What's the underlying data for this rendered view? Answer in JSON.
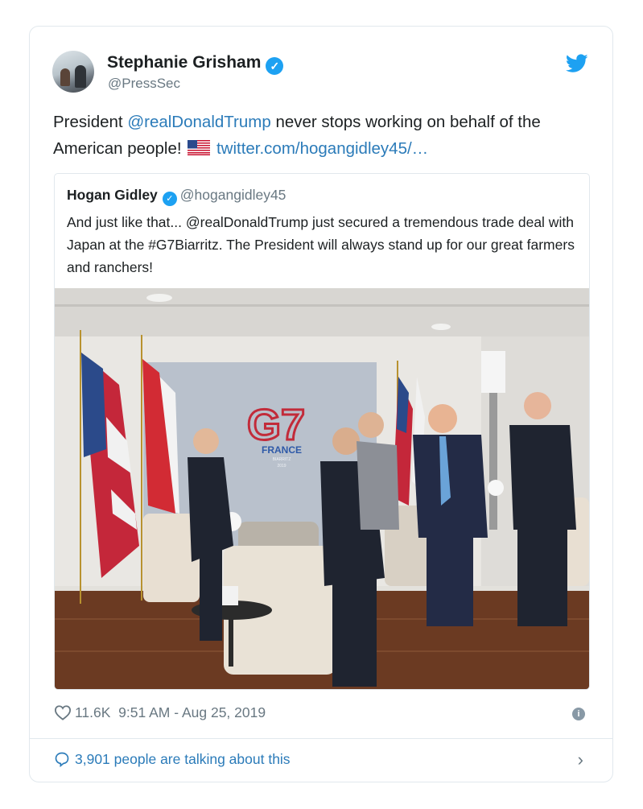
{
  "author": {
    "name": "Stephanie Grisham",
    "handle": "@PressSec",
    "verified_icon": "verified-check-icon"
  },
  "tweet": {
    "text_before_mention": "President ",
    "mention": "@realDonaldTrump",
    "text_after_mention": " never stops working on behalf of the American people! ",
    "flag_icon": "us-flag-emoji",
    "link": "twitter.com/hogangidley45/…"
  },
  "quote": {
    "name": "Hogan Gidley",
    "handle": "@hogangidley45",
    "text": "And just like that... @realDonaldTrump just secured a tremendous trade deal with Japan at the #G7Biarritz. The President will always stand up for our great farmers and ranchers!",
    "photo": {
      "sign_main": "G7",
      "sign_sub": "FRANCE",
      "sign_city": "BIARRITZ",
      "sign_year": "2019"
    }
  },
  "meta": {
    "likes": "11.6K",
    "timestamp": "9:51 AM - Aug 25, 2019"
  },
  "conversation": {
    "label": "3,901 people are talking about this"
  },
  "colors": {
    "link": "#2b7bb9",
    "verified": "#1da1f2",
    "muted": "#697882",
    "border": "#e1e8ed"
  }
}
